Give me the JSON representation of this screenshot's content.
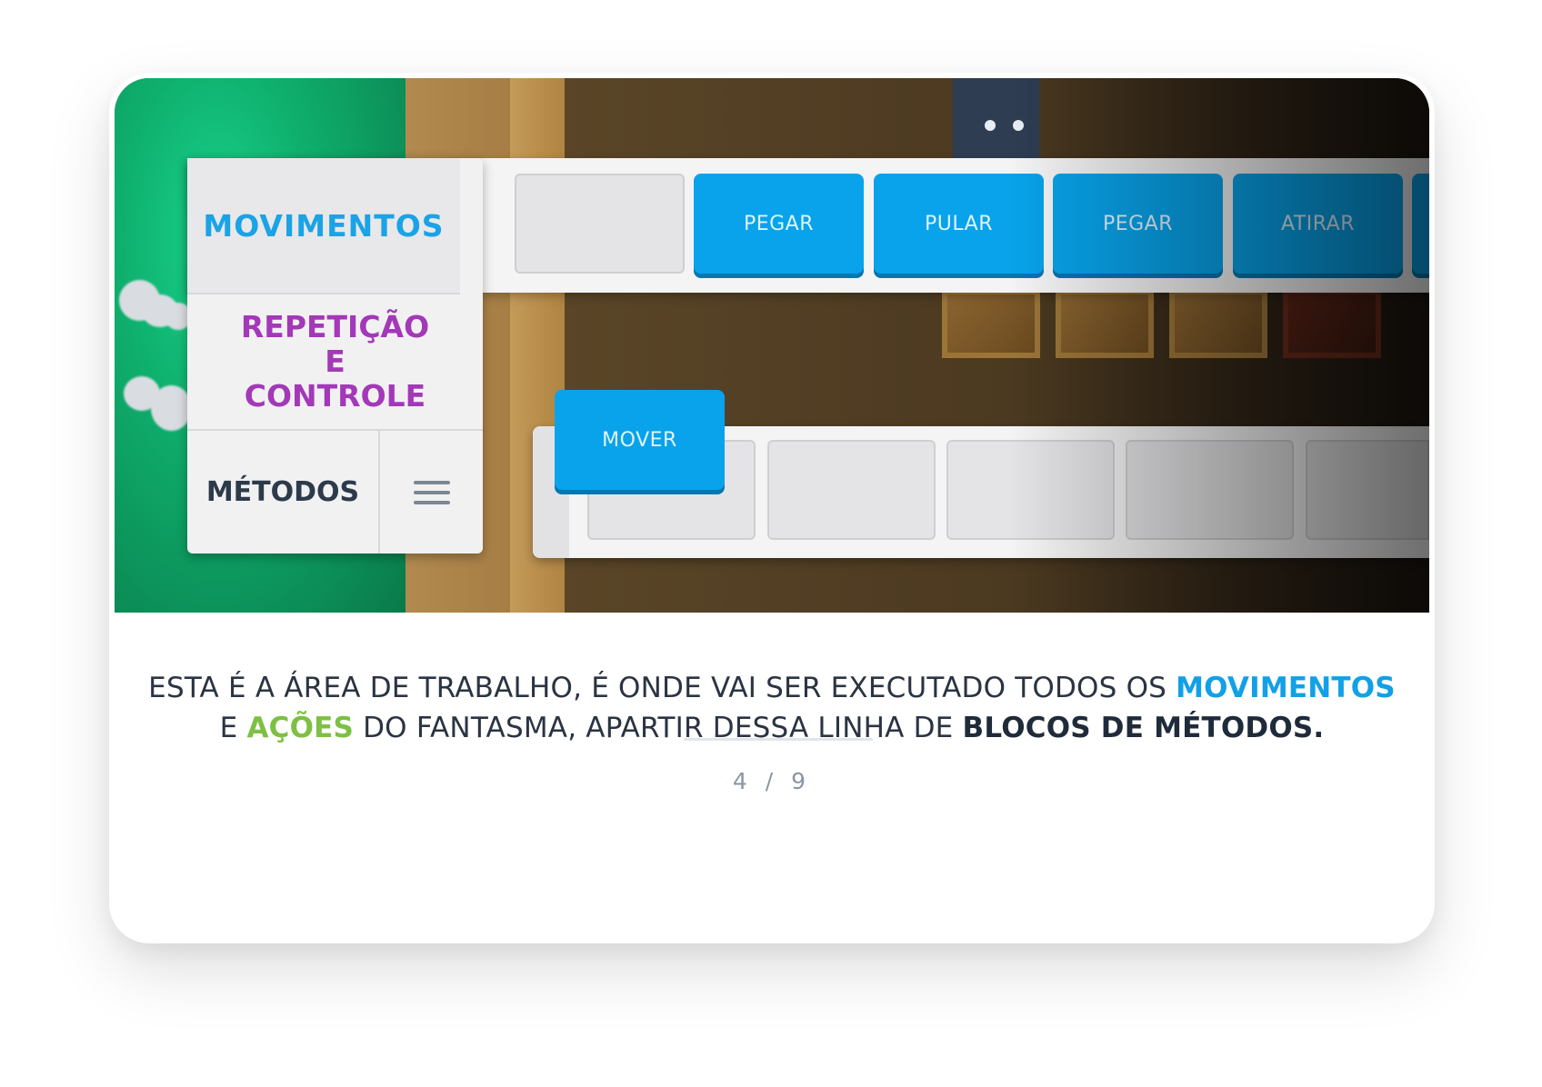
{
  "scene": {
    "categories": {
      "movimentos": "MOVIMENTOS",
      "repeticao": "REPETIÇÃO E CONTROLE",
      "metodos": "MÉTODOS"
    },
    "top_blocks": [
      "PEGAR",
      "PULAR",
      "PEGAR",
      "ATIRAR"
    ],
    "dragged_block": "MOVER",
    "menu_icon": "hamburger-menu-icon"
  },
  "caption": {
    "part1": "ESTA É A ÁREA DE TRABALHO, É ONDE VAI SER EXECUTADO TODOS OS ",
    "movimentos": "MOVIMENTOS",
    "part2": "E ",
    "acoes": "AÇÕES",
    "part3": " DO FANTASMA, APARTIR DESSA LINHA DE ",
    "blocos": "BLOCOS DE MÉTODOS."
  },
  "pagination": {
    "current": "4",
    "separator": "/",
    "total": "9"
  },
  "colors": {
    "blue": "#12a0e6",
    "green": "#7dc043",
    "purple": "#a338b8",
    "dark": "#1f2b3a"
  }
}
